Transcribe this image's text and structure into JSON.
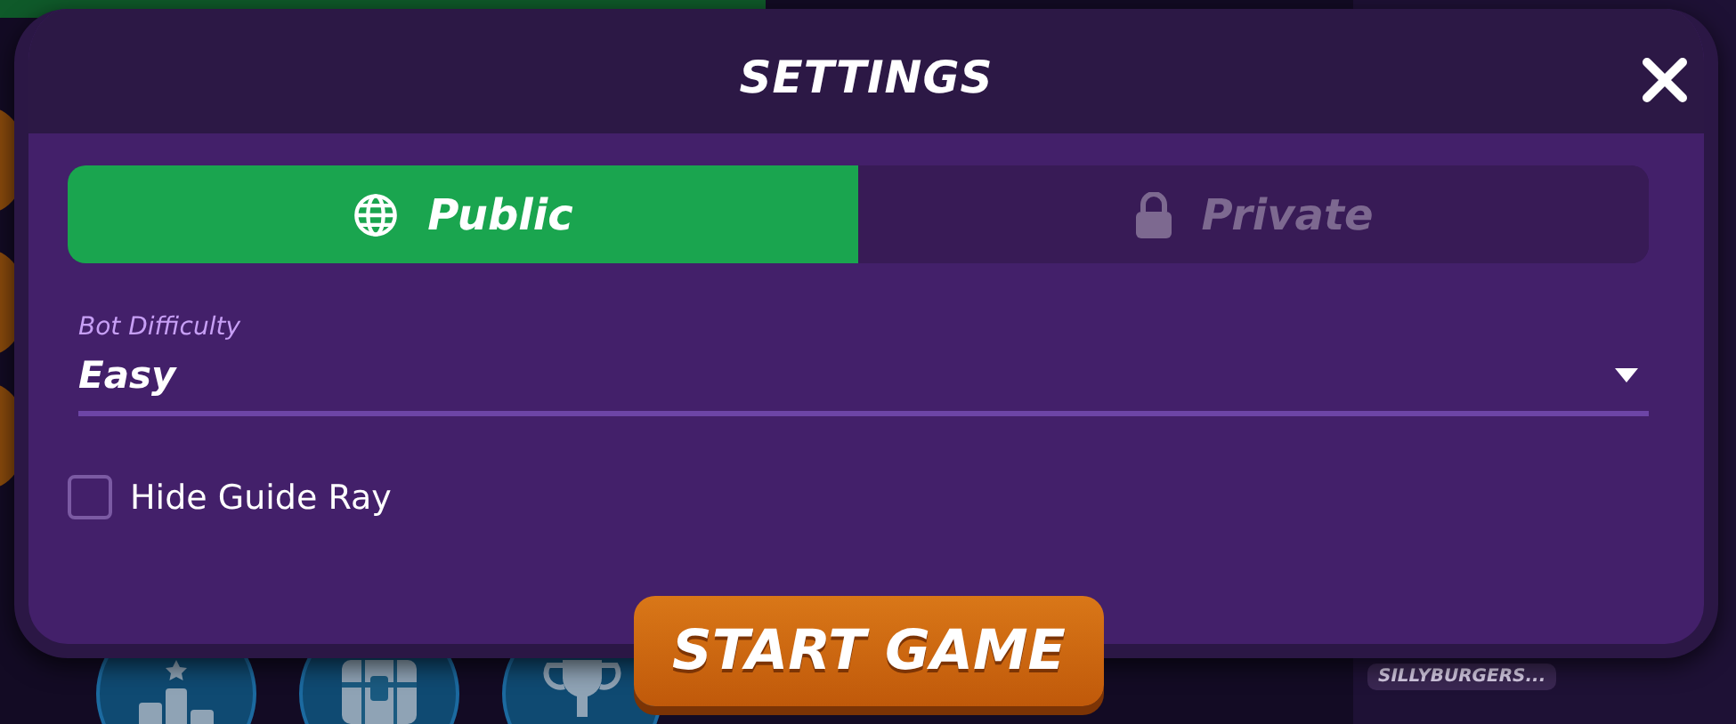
{
  "dialog": {
    "title": "SETTINGS",
    "tabs": [
      {
        "label": "Public",
        "kind": "globe",
        "selected": true
      },
      {
        "label": "Private",
        "kind": "lock",
        "selected": false
      }
    ],
    "bot_difficulty": {
      "label": "Bot Difficulty",
      "value": "Easy"
    },
    "hide_guide_ray": {
      "label": "Hide Guide Ray",
      "checked": false
    },
    "start_button": "START GAME"
  },
  "background": {
    "menu_buttons": [
      {
        "kind": "podium"
      },
      {
        "kind": "chest"
      },
      {
        "kind": "trophy"
      }
    ],
    "player_tag": "SILLYBURGERS..."
  }
}
